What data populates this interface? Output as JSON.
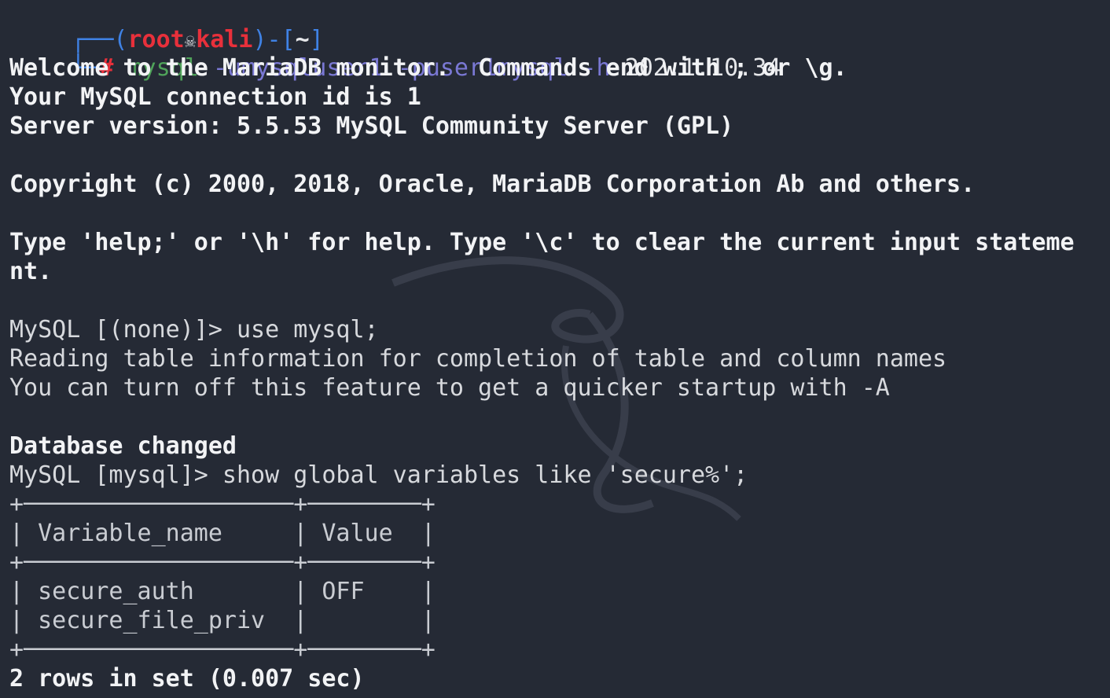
{
  "colors": {
    "background": "#252a35",
    "prompt_frame": "#3f82e5",
    "prompt_user": "#e8303b",
    "command": "#4fa35a",
    "argument": "#7a78d4",
    "text": "#d7d9dd"
  },
  "prompt": {
    "frame_left": "┌──(",
    "user": "root",
    "skull_icon": "💀",
    "host": "kali",
    "frame_mid": ")-[",
    "dir": "~",
    "frame_right": "]",
    "corner": "└─",
    "hash": "#",
    "command": "mysql",
    "arg_user": "-umysqluser1",
    "arg_pass": "-puser1mysql",
    "arg_host_flag": "-h",
    "host_ip": "202.1.10.34"
  },
  "output": {
    "welcome": "Welcome to the MariaDB monitor.  Commands end with ; or \\g.",
    "connection": "Your MySQL connection id is 1",
    "server_version": "Server version: 5.5.53 MySQL Community Server (GPL)",
    "copyright": "Copyright (c) 2000, 2018, Oracle, MariaDB Corporation Ab and others.",
    "help_1": "Type 'help;' or '\\h' for help. Type '\\c' to clear the current input stateme",
    "help_2": "nt.",
    "prompt_1": "MySQL [(none)]> use mysql;",
    "reading": "Reading table information for completion of table and column names",
    "turn_off": "You can turn off this feature to get a quicker startup with -A",
    "db_changed": "Database changed",
    "prompt_2": "MySQL [mysql]> show global variables like 'secure%';",
    "table_border_top": "+───────────────────+────────+",
    "table_header": "| Variable_name     | Value  |",
    "table_border_mid": "+───────────────────+────────+",
    "table_row_1": "| secure_auth       | OFF    |",
    "table_row_2": "| secure_file_priv  |        |",
    "table_border_bottom": "+───────────────────+────────+",
    "rows_summary": "2 rows in set (0.007 sec)"
  }
}
